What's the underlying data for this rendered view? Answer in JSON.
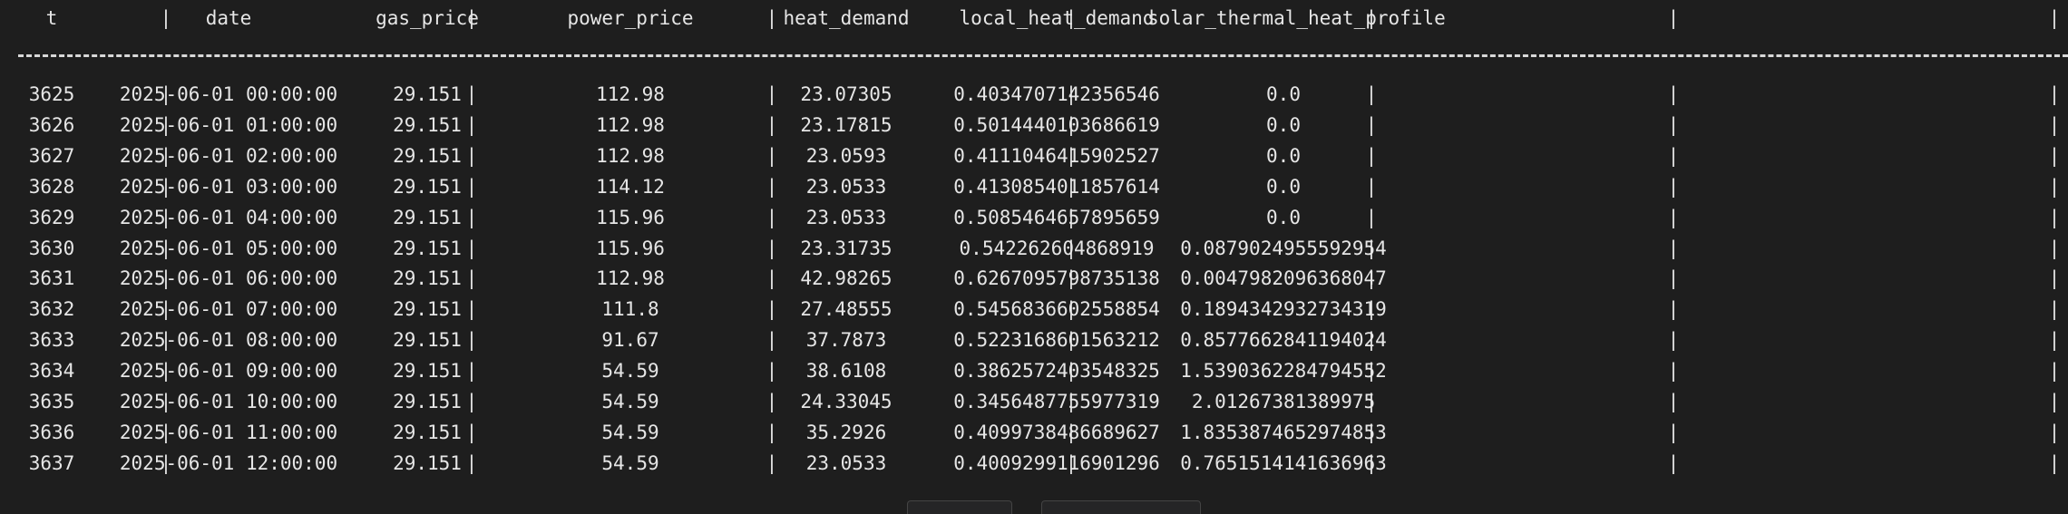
{
  "table": {
    "columns": [
      "t",
      "date",
      "gas_price",
      "power_price",
      "heat_demand",
      "local_heat_demand",
      "solar_thermal_heat_profile"
    ],
    "separator": "|",
    "rows": [
      [
        "3625",
        "2025-06-01 00:00:00",
        "29.151",
        "112.98",
        "23.07305",
        "0.4034707142356546",
        "0.0"
      ],
      [
        "3626",
        "2025-06-01 01:00:00",
        "29.151",
        "112.98",
        "23.17815",
        "0.5014440103686619",
        "0.0"
      ],
      [
        "3627",
        "2025-06-01 02:00:00",
        "29.151",
        "112.98",
        "23.0593",
        "0.4111046415902527",
        "0.0"
      ],
      [
        "3628",
        "2025-06-01 03:00:00",
        "29.151",
        "114.12",
        "23.0533",
        "0.4130854011857614",
        "0.0"
      ],
      [
        "3629",
        "2025-06-01 04:00:00",
        "29.151",
        "115.96",
        "23.0533",
        "0.5085464657895659",
        "0.0"
      ],
      [
        "3630",
        "2025-06-01 05:00:00",
        "29.151",
        "115.96",
        "23.31735",
        "0.542262604868919",
        "0.0879024955592954"
      ],
      [
        "3631",
        "2025-06-01 06:00:00",
        "29.151",
        "112.98",
        "42.98265",
        "0.6267095798735138",
        "0.0047982096368047"
      ],
      [
        "3632",
        "2025-06-01 07:00:00",
        "29.151",
        "111.8",
        "27.48555",
        "0.5456836602558854",
        "0.1894342932734319"
      ],
      [
        "3633",
        "2025-06-01 08:00:00",
        "29.151",
        "91.67",
        "37.7873",
        "0.5223168601563212",
        "0.8577662841194024"
      ],
      [
        "3634",
        "2025-06-01 09:00:00",
        "29.151",
        "54.59",
        "38.6108",
        "0.3862572403548325",
        "1.5390362284794552"
      ],
      [
        "3635",
        "2025-06-01 10:00:00",
        "29.151",
        "54.59",
        "24.33045",
        "0.3456487755977319",
        "2.01267381389975"
      ],
      [
        "3636",
        "2025-06-01 11:00:00",
        "29.151",
        "54.59",
        "35.2926",
        "0.4099738486689627",
        "1.8353874652974853"
      ],
      [
        "3637",
        "2025-06-01 12:00:00",
        "29.151",
        "54.59",
        "23.0533",
        "0.4009299116901296",
        "0.7651514141636963"
      ]
    ]
  },
  "colors": {
    "background": "#1e1e1e",
    "text": "#e6e6e6",
    "rule": "#d8d8d8"
  }
}
